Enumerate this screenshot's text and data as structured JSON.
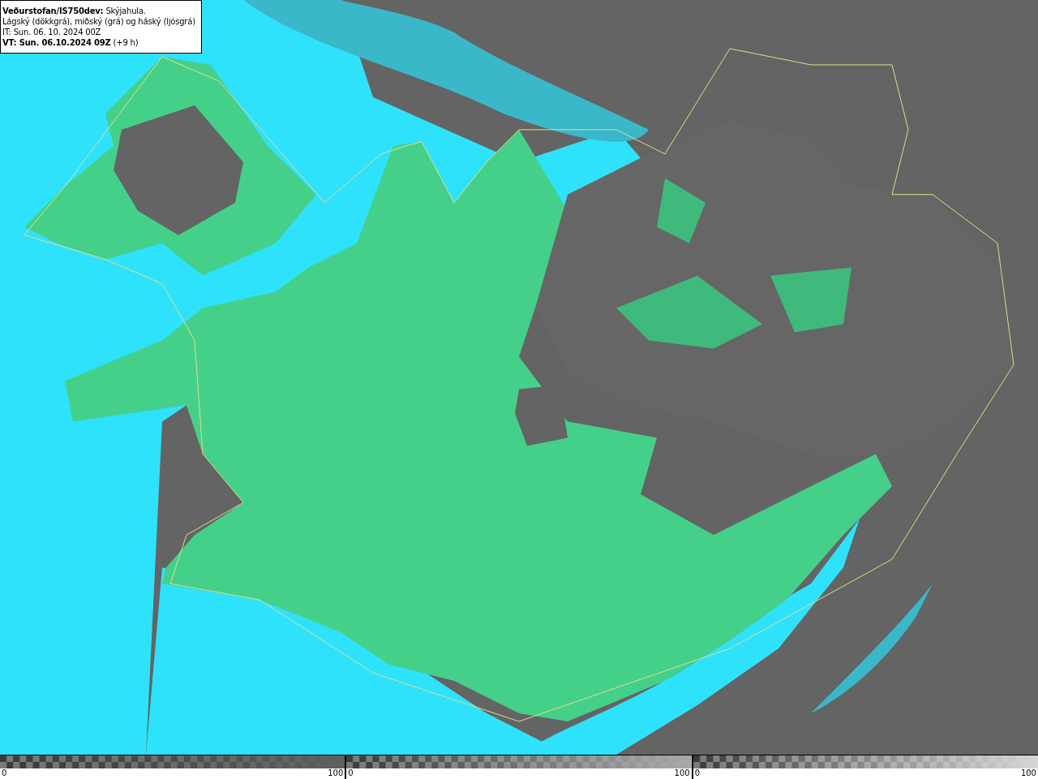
{
  "legend": {
    "lines": [
      "**Veðurstofan/IS750dev:** Skýjahula.",
      "Lágský (dökkgrá), miðský (grá) og háský (ljósgrá)",
      "IT: Sun. 06. 10. 2024 00Z",
      "**VT: Sun. 06.10.2024 09Z** (+9 h)"
    ]
  },
  "colorbars": [
    {
      "min": "0",
      "max": "100",
      "color": "#5e5e5e"
    },
    {
      "min": "0",
      "max": "100",
      "color": "#a8a8a8"
    },
    {
      "min": "0",
      "max": "100",
      "color": "#d6d6d6"
    }
  ]
}
